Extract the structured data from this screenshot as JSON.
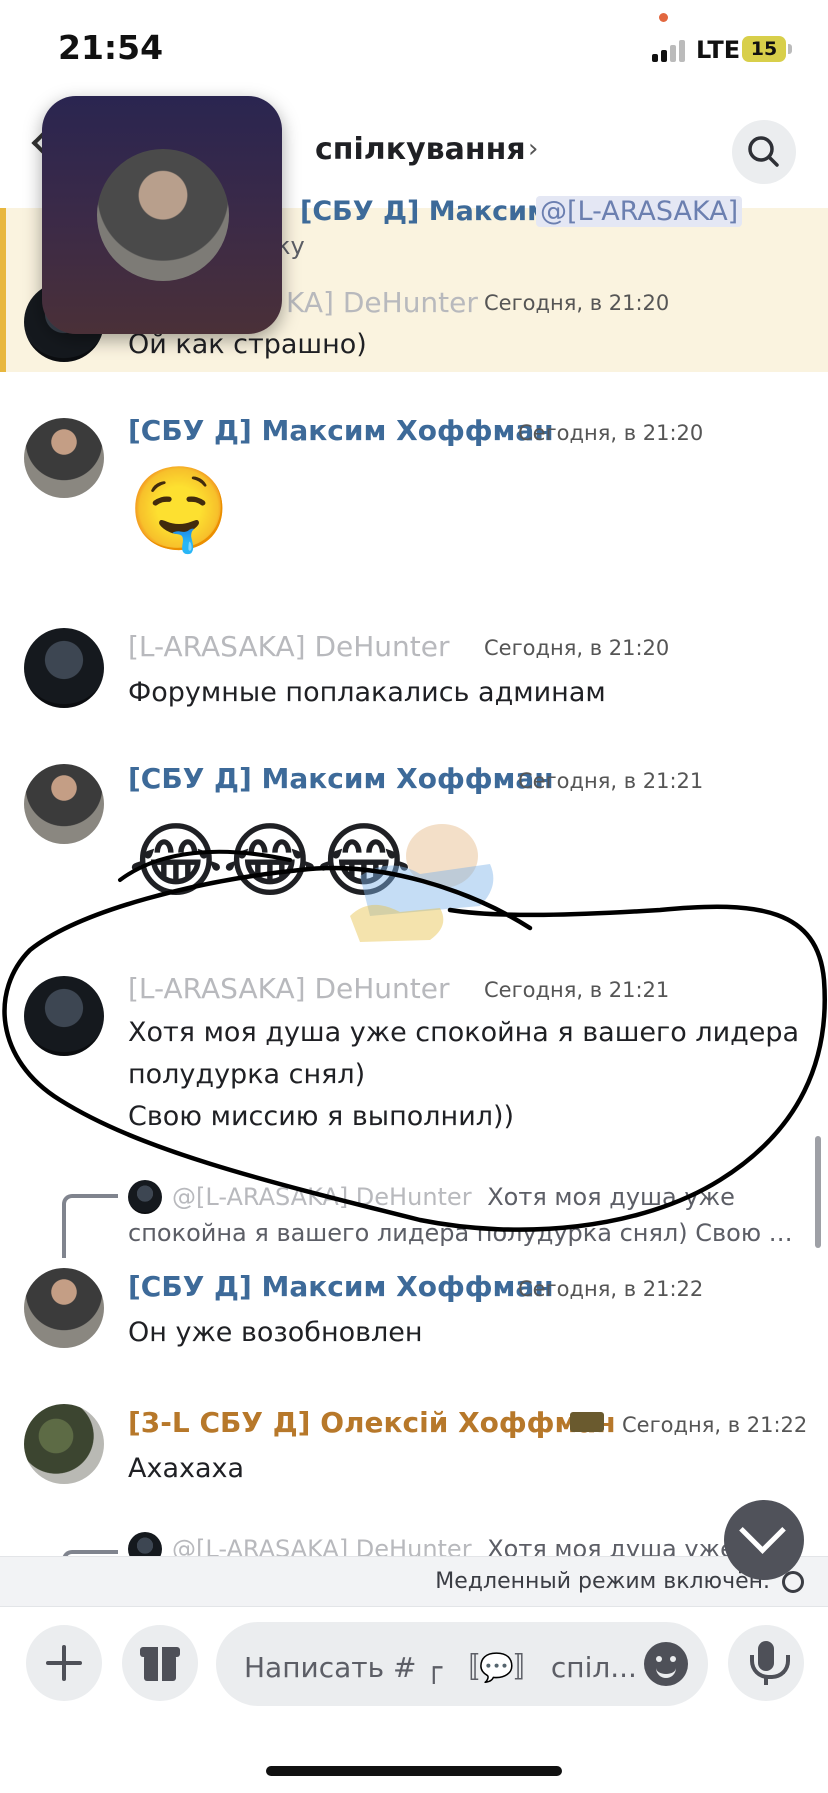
{
  "status_bar": {
    "time": "21:54",
    "network": "LTE",
    "battery": "15"
  },
  "header": {
    "bracket_symbol": "]",
    "channel_name": "спілкування",
    "chevron": "›"
  },
  "highlight": {
    "reply_name": "[СБУ Д] Максим Хоффман",
    "reply_mention": "@[L-ARASAKA]",
    "reply_text": "ку",
    "author": "KA] DeHunter",
    "time": "Сегодня, в 21:20",
    "text": "Ой как страшно)"
  },
  "messages": [
    {
      "author": "[СБУ Д] Максим Хоффман",
      "time": "Сегодня, в 21:20",
      "emoji": "🤤"
    },
    {
      "author": "[L-ARASAKA] DeHunter",
      "time": "Сегодня, в 21:20",
      "text": "Форумные поплакались админам"
    },
    {
      "author": "[СБУ Д] Максим Хоффман",
      "time": "Сегодня, в 21:21",
      "emojis": [
        "😂",
        "😂",
        "😂"
      ]
    },
    {
      "author": "[L-ARASAKA] DeHunter",
      "time": "Сегодня, в 21:21",
      "lines": [
        "Хотя моя душа уже спокойна я вашего лидера",
        "полудурка снял)",
        "Свою миссию я выполнил))"
      ]
    },
    {
      "reply_user": "@[L-ARASAKA] DeHunter",
      "reply_text_1": "Хотя моя душа уже",
      "reply_text_2": "спокойна я вашего лидера полудурка снял) Свою …",
      "author": "[СБУ Д] Максим Хоффман",
      "time": "Сегодня, в 21:22",
      "text": "Он уже возобновлен"
    },
    {
      "author": "[3-L СБУ Д] Олексій Хоффман",
      "time": "Сегодня, в 21:22",
      "text": "Ахахаха"
    },
    {
      "reply_user": "@[L-ARASAKA] DeHunter",
      "reply_text_1": "Хотя моя душа уже"
    }
  ],
  "slowmode": {
    "label": "Медленный режим включён."
  },
  "composer": {
    "placeholder": "Написать # ┌ 〚💬〛 спіл..."
  },
  "colors": {
    "sbu_name": "#3d6a99",
    "l_name": "#b8b9bd",
    "three_l_name": "#b7782a",
    "highlight_bg": "#faf3df",
    "highlight_border": "#e8b73e"
  },
  "icons": [
    "search-icon",
    "back-arrow-icon",
    "plus-icon",
    "gift-icon",
    "emoji-icon",
    "mic-icon",
    "chevron-down-icon",
    "clock-icon"
  ]
}
